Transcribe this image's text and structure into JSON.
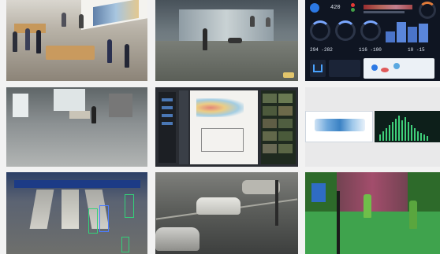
{
  "dashboard": {
    "counter": "420",
    "readouts": [
      {
        "a": "294",
        "b": "-282"
      },
      {
        "a": "116",
        "b": "-100"
      },
      {
        "a": "10",
        "b": "-15"
      }
    ]
  },
  "tiles": [
    {
      "name": "retail-store-feed"
    },
    {
      "name": "mall-corridor-feed"
    },
    {
      "name": "analytics-dashboard"
    },
    {
      "name": "office-lobby-feed"
    },
    {
      "name": "crowd-heatmap-software"
    },
    {
      "name": "heatmap-histogram-panel"
    },
    {
      "name": "station-escalator-tracking"
    },
    {
      "name": "street-parking-feed"
    },
    {
      "name": "escalator-segmentation-feed"
    }
  ]
}
